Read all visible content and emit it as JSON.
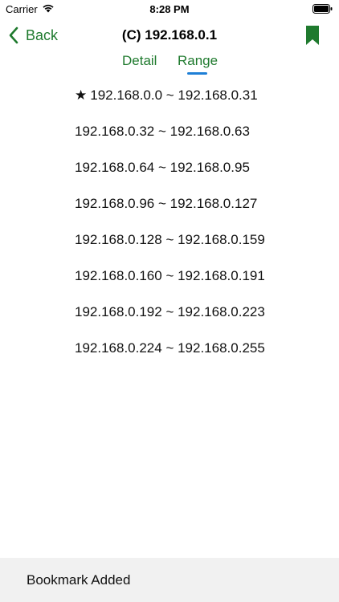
{
  "status_bar": {
    "carrier": "Carrier",
    "time": "8:28 PM"
  },
  "nav": {
    "back_label": "Back",
    "title": "(C) 192.168.0.1",
    "bookmark_icon": "bookmark-icon",
    "accent_color": "#1f7a2e"
  },
  "tabs": [
    {
      "label": "Detail",
      "selected": false
    },
    {
      "label": "Range",
      "selected": true
    }
  ],
  "tab_indicator_color": "#1e7fd6",
  "ranges": [
    {
      "label": "192.168.0.0 ~ 192.168.0.31",
      "starred": true
    },
    {
      "label": "192.168.0.32 ~ 192.168.0.63",
      "starred": false
    },
    {
      "label": "192.168.0.64 ~ 192.168.0.95",
      "starred": false
    },
    {
      "label": "192.168.0.96 ~ 192.168.0.127",
      "starred": false
    },
    {
      "label": "192.168.0.128 ~ 192.168.0.159",
      "starred": false
    },
    {
      "label": "192.168.0.160 ~ 192.168.0.191",
      "starred": false
    },
    {
      "label": "192.168.0.192 ~ 192.168.0.223",
      "starred": false
    },
    {
      "label": "192.168.0.224 ~ 192.168.0.255",
      "starred": false
    }
  ],
  "star_glyph": "★",
  "toast": {
    "message": "Bookmark Added"
  }
}
